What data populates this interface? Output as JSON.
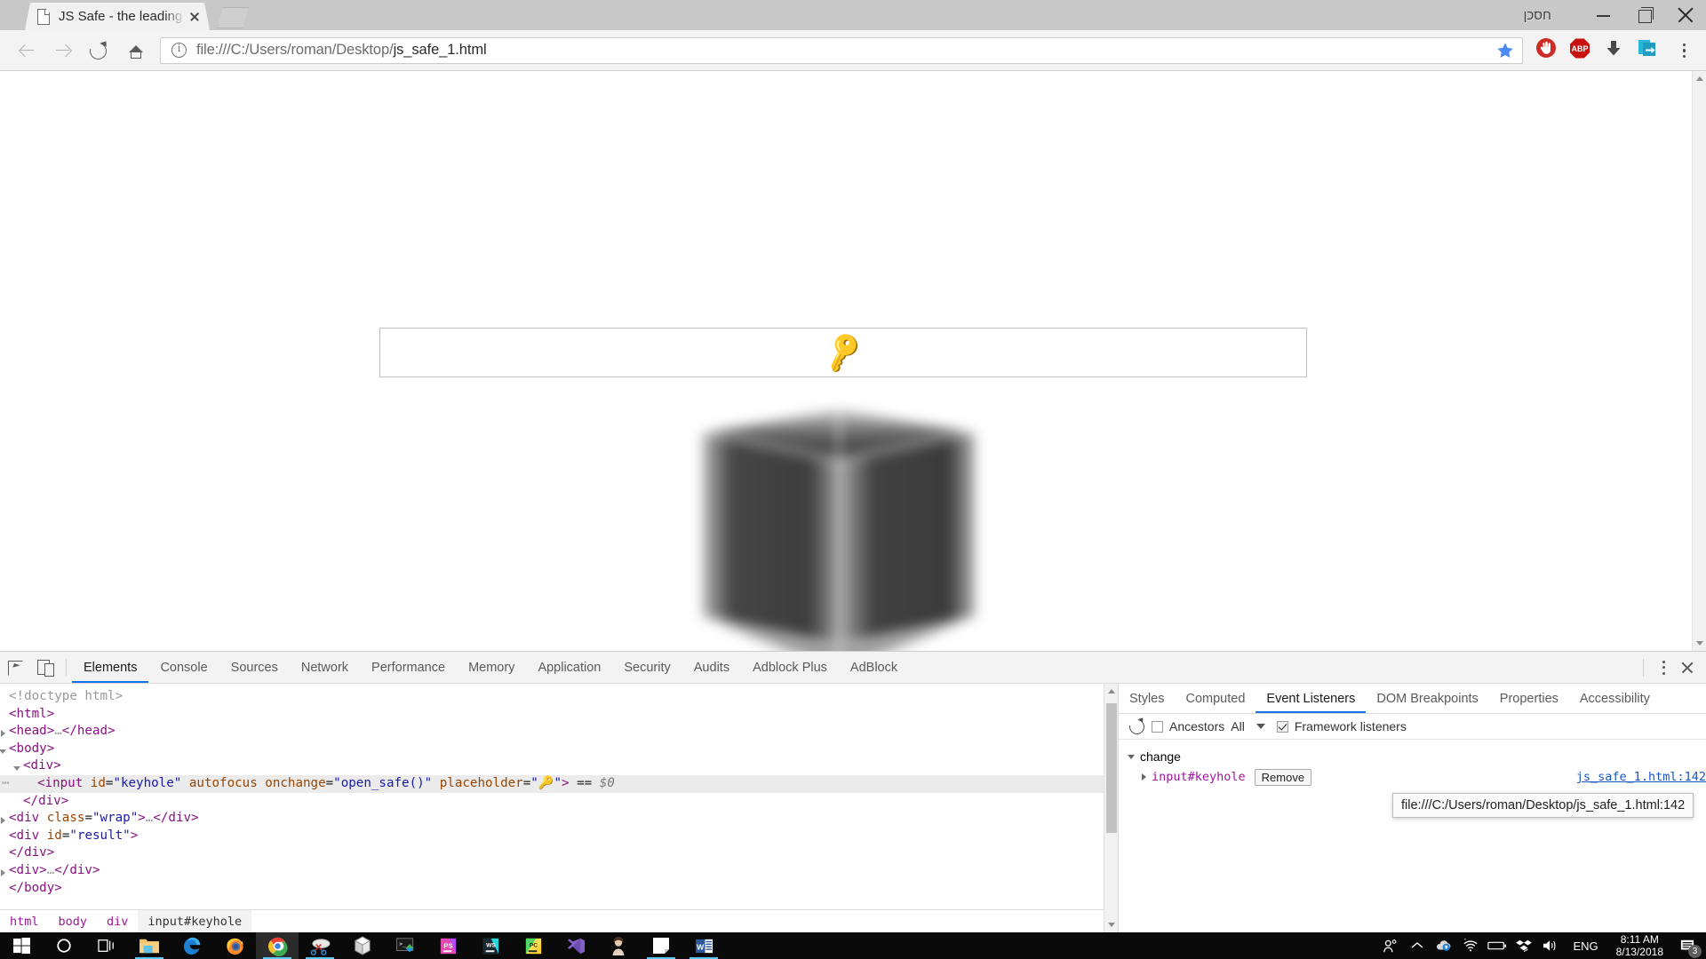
{
  "browser": {
    "tab": {
      "title": "JS Safe - the leading local",
      "favicon_icon": "page-icon",
      "close_icon": "close-icon"
    },
    "new_tab_label": "",
    "window": {
      "hebrew_label": "חסכן",
      "minimize_icon": "minimize-icon",
      "maximize_icon": "maximize-icon",
      "close_icon": "close-icon"
    },
    "nav": {
      "back_icon": "arrow-left-icon",
      "forward_icon": "arrow-right-icon",
      "reload_icon": "reload-icon",
      "home_icon": "home-icon"
    },
    "omnibox": {
      "info_icon": "info-circle-icon",
      "url_scheme": "file:///C:/Users/roman/Desktop/",
      "url_file": "js_safe_1.html",
      "full_url": "file:///C:/Users/roman/Desktop/js_safe_1.html",
      "bookmark_icon": "star-icon",
      "bookmark_color": "#4a8bf5"
    },
    "extensions": [
      {
        "name": "ublock-origin-icon",
        "label": "",
        "color": "#cc2b26"
      },
      {
        "name": "adblock-plus-icon",
        "label": "ABP",
        "color": "#c9110f"
      },
      {
        "name": "download-icon",
        "label": "",
        "color": "#4a4a4a"
      },
      {
        "name": "send-to-device-icon",
        "label": "",
        "color": "#29b6d8"
      }
    ],
    "menu_icon": "kebab-menu-icon"
  },
  "page": {
    "input": {
      "value": "",
      "placeholder_emoji": "🔑",
      "id": "keyhole"
    },
    "cube": {
      "name": "safe-cube-graphic",
      "color": "#4a4a4a"
    },
    "scrollbar": {
      "up_icon": "scroll-up-icon",
      "down_icon": "scroll-down-icon"
    }
  },
  "devtools": {
    "inspect_icon": "inspect-element-icon",
    "device_icon": "device-toolbar-icon",
    "tabs": [
      {
        "label": "Elements",
        "active": true
      },
      {
        "label": "Console",
        "active": false
      },
      {
        "label": "Sources",
        "active": false
      },
      {
        "label": "Network",
        "active": false
      },
      {
        "label": "Performance",
        "active": false
      },
      {
        "label": "Memory",
        "active": false
      },
      {
        "label": "Application",
        "active": false
      },
      {
        "label": "Security",
        "active": false
      },
      {
        "label": "Audits",
        "active": false
      },
      {
        "label": "Adblock Plus",
        "active": false
      },
      {
        "label": "AdBlock",
        "active": false
      }
    ],
    "more_icon": "kebab-menu-icon",
    "close_icon": "close-icon",
    "dom_lines": [
      {
        "indent": 0,
        "twisty": "none",
        "parts": [
          {
            "c": "c-gray",
            "t": "<!doctype html>"
          }
        ]
      },
      {
        "indent": 0,
        "twisty": "none",
        "parts": [
          {
            "c": "c-tag",
            "t": "<html>"
          }
        ]
      },
      {
        "indent": 0,
        "twisty": "closed",
        "parts": [
          {
            "c": "c-tag",
            "t": "<head>"
          },
          {
            "c": "c-gray",
            "t": "…"
          },
          {
            "c": "c-tag",
            "t": "</head>"
          }
        ]
      },
      {
        "indent": 0,
        "twisty": "open",
        "parts": [
          {
            "c": "c-tag",
            "t": "<body>"
          }
        ]
      },
      {
        "indent": 1,
        "twisty": "open",
        "parts": [
          {
            "c": "c-tag",
            "t": "<div>"
          }
        ]
      },
      {
        "indent": 2,
        "twisty": "none",
        "selected": true,
        "ellipsis": true,
        "parts": [
          {
            "c": "c-tag",
            "t": "<input "
          },
          {
            "c": "c-attr",
            "t": "id"
          },
          {
            "c": "c-punct",
            "t": "="
          },
          {
            "c": "c-val",
            "t": "\"keyhole\""
          },
          {
            "c": "c-punct",
            "t": " "
          },
          {
            "c": "c-attr",
            "t": "autofocus"
          },
          {
            "c": "c-punct",
            "t": " "
          },
          {
            "c": "c-attr",
            "t": "onchange"
          },
          {
            "c": "c-punct",
            "t": "="
          },
          {
            "c": "c-val",
            "t": "\"open_safe()\""
          },
          {
            "c": "c-punct",
            "t": " "
          },
          {
            "c": "c-attr",
            "t": "placeholder"
          },
          {
            "c": "c-punct",
            "t": "="
          },
          {
            "c": "c-val",
            "t": "\"🔑\""
          },
          {
            "c": "c-tag",
            "t": ">"
          },
          {
            "c": "c-punct",
            "t": " == "
          },
          {
            "c": "c-dollar",
            "t": "$0"
          }
        ]
      },
      {
        "indent": 1,
        "twisty": "none",
        "parts": [
          {
            "c": "c-tag",
            "t": "</div>"
          }
        ]
      },
      {
        "indent": 0,
        "twisty": "closed",
        "parts": [
          {
            "c": "c-tag",
            "t": "<div "
          },
          {
            "c": "c-attr",
            "t": "class"
          },
          {
            "c": "c-punct",
            "t": "="
          },
          {
            "c": "c-val",
            "t": "\"wrap\""
          },
          {
            "c": "c-tag",
            "t": ">"
          },
          {
            "c": "c-gray",
            "t": "…"
          },
          {
            "c": "c-tag",
            "t": "</div>"
          }
        ]
      },
      {
        "indent": 0,
        "twisty": "none",
        "parts": [
          {
            "c": "c-tag",
            "t": "<div "
          },
          {
            "c": "c-attr",
            "t": "id"
          },
          {
            "c": "c-punct",
            "t": "="
          },
          {
            "c": "c-val",
            "t": "\"result\""
          },
          {
            "c": "c-tag",
            "t": ">"
          }
        ]
      },
      {
        "indent": 0,
        "twisty": "none",
        "parts": [
          {
            "c": "c-tag",
            "t": "</div>"
          }
        ]
      },
      {
        "indent": 0,
        "twisty": "closed",
        "parts": [
          {
            "c": "c-tag",
            "t": "<div>"
          },
          {
            "c": "c-gray",
            "t": "…"
          },
          {
            "c": "c-tag",
            "t": "</div>"
          }
        ]
      },
      {
        "indent": 0,
        "twisty": "none",
        "parts": [
          {
            "c": "c-tag",
            "t": "</body>"
          }
        ]
      }
    ],
    "breadcrumb": [
      {
        "label": "html",
        "last": false
      },
      {
        "label": "body",
        "last": false
      },
      {
        "label": "div",
        "last": false
      },
      {
        "label": "input#keyhole",
        "last": true
      }
    ],
    "sidebar": {
      "tabs": [
        {
          "label": "Styles",
          "active": false
        },
        {
          "label": "Computed",
          "active": false
        },
        {
          "label": "Event Listeners",
          "active": true
        },
        {
          "label": "DOM Breakpoints",
          "active": false
        },
        {
          "label": "Properties",
          "active": false
        },
        {
          "label": "Accessibility",
          "active": false
        }
      ],
      "toolbar": {
        "refresh_icon": "refresh-icon",
        "ancestors_label": "Ancestors",
        "ancestors_checked": false,
        "filter_value": "All",
        "framework_label": "Framework listeners",
        "framework_checked": true
      },
      "event_group": "change",
      "listener": {
        "selector": "input#keyhole",
        "remove_label": "Remove",
        "source": "js_safe_1.html:142"
      },
      "tooltip": "file:///C:/Users/roman/Desktop/js_safe_1.html:142"
    }
  },
  "taskbar": {
    "items": [
      {
        "name": "start-button",
        "icon": "windows-logo-icon",
        "active": false,
        "running": false
      },
      {
        "name": "cortana-button",
        "icon": "circle-icon",
        "active": false,
        "running": false
      },
      {
        "name": "task-view-button",
        "icon": "task-view-icon",
        "active": false,
        "running": false
      },
      {
        "name": "file-explorer",
        "icon": "folder-icon",
        "active": false,
        "running": true
      },
      {
        "name": "microsoft-edge",
        "icon": "edge-icon",
        "active": false,
        "running": false
      },
      {
        "name": "firefox",
        "icon": "firefox-icon",
        "active": false,
        "running": false
      },
      {
        "name": "google-chrome",
        "icon": "chrome-icon",
        "active": true,
        "running": true
      },
      {
        "name": "snipping-tool",
        "icon": "scissors-icon",
        "active": false,
        "running": true
      },
      {
        "name": "virtualbox",
        "icon": "cube-icon",
        "active": false,
        "running": false
      },
      {
        "name": "cmder-terminal",
        "icon": "terminal-icon",
        "active": false,
        "running": false
      },
      {
        "name": "phpstorm",
        "icon": "ps-icon",
        "active": false,
        "running": false
      },
      {
        "name": "webstorm",
        "icon": "ws-icon",
        "active": false,
        "running": false
      },
      {
        "name": "pycharm",
        "icon": "pc-icon",
        "active": false,
        "running": false
      },
      {
        "name": "visual-studio",
        "icon": "vs-icon",
        "active": false,
        "running": false
      },
      {
        "name": "portrait-app",
        "icon": "portrait-icon",
        "active": false,
        "running": false
      },
      {
        "name": "sticky-notes",
        "icon": "note-icon",
        "active": false,
        "running": true
      },
      {
        "name": "microsoft-word",
        "icon": "word-icon",
        "active": false,
        "running": true
      }
    ],
    "tray": {
      "people_icon": "people-icon",
      "chevron_icon": "chevron-up-icon",
      "onedrive_icon": "onedrive-icon",
      "wifi_icon": "wifi-icon",
      "battery_icon": "battery-icon",
      "dropbox_icon": "dropbox-icon",
      "volume_icon": "volume-icon",
      "language": "ENG",
      "time": "8:11 AM",
      "date": "8/13/2018",
      "notification_icon": "notification-icon",
      "notification_count": "3"
    }
  }
}
